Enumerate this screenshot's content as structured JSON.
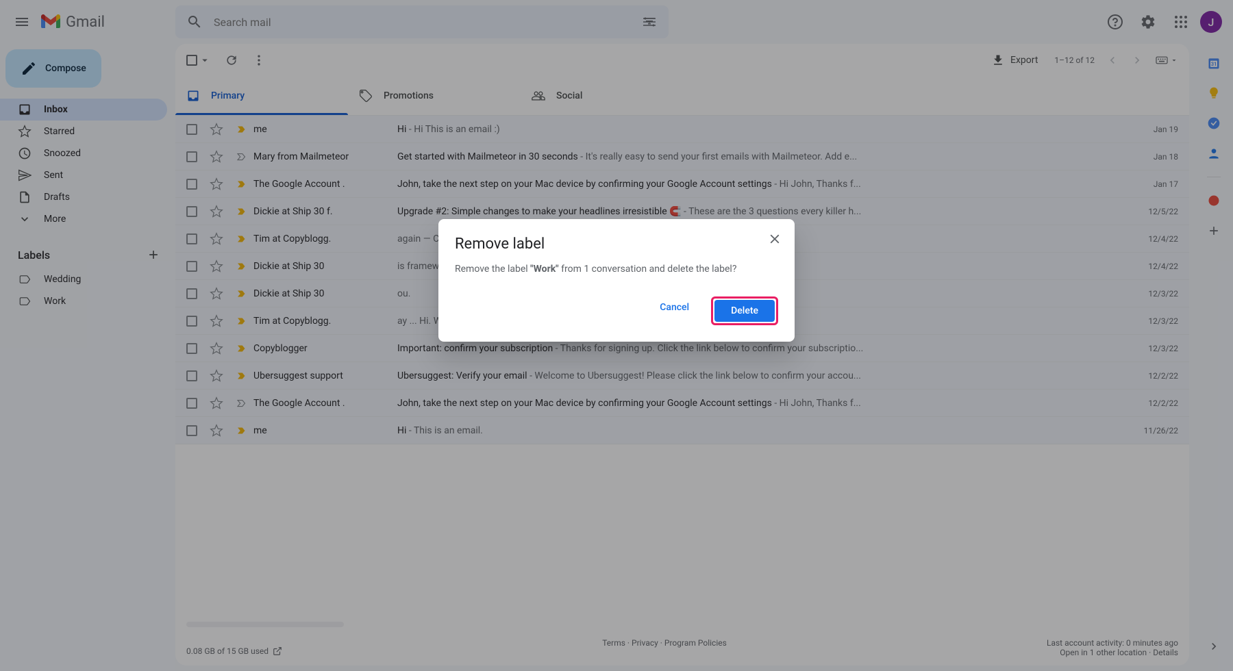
{
  "header": {
    "app_name": "Gmail",
    "search_placeholder": "Search mail",
    "avatar_initial": "J"
  },
  "compose_label": "Compose",
  "sidebar": {
    "items": [
      {
        "label": "Inbox",
        "active": true
      },
      {
        "label": "Starred"
      },
      {
        "label": "Snoozed"
      },
      {
        "label": "Sent"
      },
      {
        "label": "Drafts"
      },
      {
        "label": "More"
      }
    ],
    "labels_header": "Labels",
    "labels": [
      {
        "label": "Wedding"
      },
      {
        "label": "Work"
      }
    ]
  },
  "toolbar": {
    "export": "Export",
    "pagination": "1–12 of 12"
  },
  "tabs": [
    {
      "label": "Primary",
      "active": true
    },
    {
      "label": "Promotions"
    },
    {
      "label": "Social"
    }
  ],
  "emails": [
    {
      "imp": true,
      "sender": "me",
      "subject": "Hi",
      "preview": "Hi This is an email :)",
      "date": "Jan 19"
    },
    {
      "imp": false,
      "sender": "Mary from Mailmeteor",
      "subject": "Get started with Mailmeteor in 30 seconds",
      "preview": "It's really easy to send your first emails with Mailmeteor. Add e...",
      "date": "Jan 18"
    },
    {
      "imp": true,
      "sender": "The Google Account .",
      "subject": "John, take the next step on your Mac device by confirming your Google Account settings",
      "preview": "Hi John, Thanks f...",
      "date": "Jan 17"
    },
    {
      "imp": true,
      "sender": "Dickie at Ship 30 f.",
      "subject": "Upgrade #2: Simple changes to make your headlines irresistible 🧲",
      "preview": "These are the 3 questions every killer h...",
      "date": "12/5/22"
    },
    {
      "imp": true,
      "sender": "Tim at Copyblogg.",
      "subject": "",
      "preview": "again — Copyblogger's CEO. I hope you ha...",
      "date": "12/4/22"
    },
    {
      "imp": true,
      "sender": "Dickie at Ship 30",
      "subject": "",
      "preview": "is framework, you'll never stare at a blank p...",
      "date": "12/4/22"
    },
    {
      "imp": true,
      "sender": "Dickie at Ship 30",
      "subject": "",
      "preview": "ou.",
      "date": "12/3/22"
    },
    {
      "imp": true,
      "sender": "Tim at Copyblogg.",
      "subject": "",
      "preview": "ay ... Hi. Welcome to the Copyblogger famil...",
      "date": "12/3/22"
    },
    {
      "imp": true,
      "sender": "Copyblogger",
      "subject": "Important: confirm your subscription",
      "preview": "Thanks for signing up. Click the link below to confirm your subscriptio...",
      "date": "12/3/22"
    },
    {
      "imp": true,
      "sender": "Ubersuggest support",
      "subject": "Ubersuggest: Verify your email",
      "preview": "Welcome to Ubersuggest! Please click the link below to confirm your accou...",
      "date": "12/2/22"
    },
    {
      "imp": false,
      "sender": "The Google Account .",
      "subject": "John, take the next step on your Mac device by confirming your Google Account settings",
      "preview": "Hi John, Thanks f...",
      "date": "12/2/22"
    },
    {
      "imp": true,
      "sender": "me",
      "subject": "Hi",
      "preview": "This is an email.",
      "date": "11/26/22"
    }
  ],
  "footer": {
    "terms": "Terms",
    "privacy": "Privacy",
    "policies": "Program Policies",
    "storage": "0.08 GB of 15 GB used",
    "activity": "Last account activity: 0 minutes ago",
    "location": "Open in 1 other location",
    "details": "Details"
  },
  "dialog": {
    "title": "Remove label",
    "body_prefix": "Remove the label ",
    "label_name": "\"Work\"",
    "body_suffix": " from 1 conversation and delete the label?",
    "cancel": "Cancel",
    "delete": "Delete"
  }
}
